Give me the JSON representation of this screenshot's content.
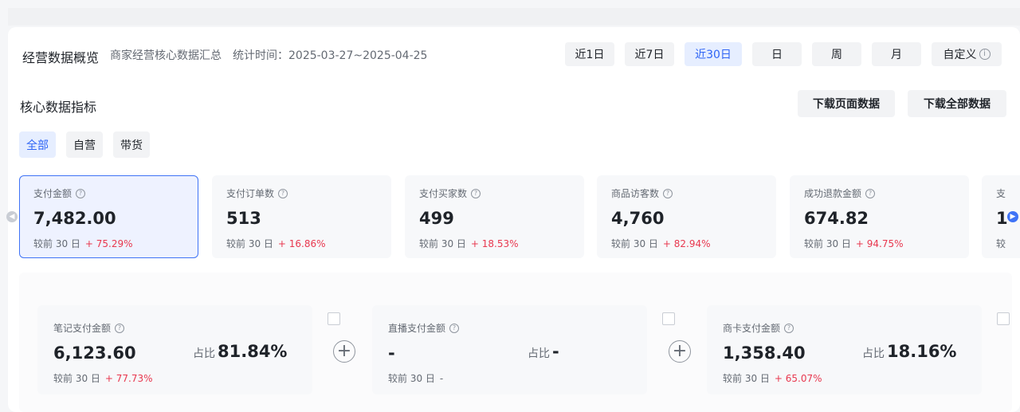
{
  "header": {
    "title": "经营数据概览",
    "subtitle": "商家经营核心数据汇总",
    "time_label": "统计时间：",
    "time_range": "2025-03-27~2025-04-25",
    "ranges": [
      {
        "label": "近1日"
      },
      {
        "label": "近7日"
      },
      {
        "label": "近30日",
        "active": true
      },
      {
        "label": "日"
      },
      {
        "label": "周"
      },
      {
        "label": "月"
      },
      {
        "label": "自定义"
      }
    ],
    "info_icon": "info-circle-icon"
  },
  "core": {
    "title": "核心数据指标",
    "download_page_label": "下载页面数据",
    "download_all_label": "下载全部数据",
    "filters": [
      {
        "label": "全部",
        "active": true
      },
      {
        "label": "自营"
      },
      {
        "label": "带货"
      }
    ]
  },
  "metrics": [
    {
      "label": "支付金额",
      "value": "7,482.00",
      "compare": "较前 30 日",
      "change": "+ 75.29%",
      "active": true
    },
    {
      "label": "支付订单数",
      "value": "513",
      "compare": "较前 30 日",
      "change": "+ 16.86%"
    },
    {
      "label": "支付买家数",
      "value": "499",
      "compare": "较前 30 日",
      "change": "+ 18.53%"
    },
    {
      "label": "商品访客数",
      "value": "4,760",
      "compare": "较前 30 日",
      "change": "+ 82.94%"
    },
    {
      "label": "成功退款金额",
      "value": "674.82",
      "compare": "较前 30 日",
      "change": "+ 94.75%"
    },
    {
      "label": "支",
      "value": "1",
      "compare": "较"
    }
  ],
  "breakdown": [
    {
      "label": "笔记支付金额",
      "value": "6,123.60",
      "share_label": "占比",
      "share": "81.84%",
      "compare": "较前 30 日",
      "change": "+ 77.73%"
    },
    {
      "label": "直播支付金额",
      "value": "-",
      "share_label": "占比",
      "share": "-",
      "compare": "较前 30 日",
      "change": "-"
    },
    {
      "label": "商卡支付金额",
      "value": "1,358.40",
      "share_label": "占比",
      "share": "18.16%",
      "compare": "较前 30 日",
      "change": "+ 65.07%"
    }
  ],
  "colors": {
    "accent": "#2e64f5",
    "increase": "#e8384f",
    "active_border": "#3f73f6"
  }
}
